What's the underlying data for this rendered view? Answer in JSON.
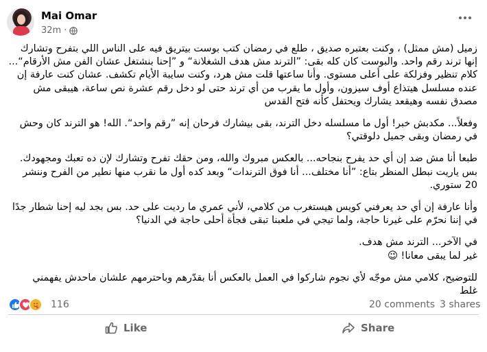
{
  "post": {
    "author": "Mai Omar",
    "time": "32m",
    "separator": "·",
    "audience_icon": "globe-icon"
  },
  "content": {
    "paragraphs": [
      {
        "lines": [
          "زميل (مش ممثل) ، وكنت بعتبره صديق ، طلع في رمضان كتب بوست بيتريق فيه على الناس اللي بتفرح وتشارك",
          "إنها ترند رقم واحد. والبوست كان كله بقى: ”الترند مش هدف الشغلانة“ و ”إحنا بنشتغل عشان الفن مش الأرقام“...",
          "كلام تنظير وفزلكة على أعلى مستوى. وأنا ساعتها قلت مش هرد، وكنت سايبة الأيام تكشف. عشان كنت عارفة إن",
          "عنده مسلسل هيتذاع أوف سيزون، وأول ما يقرب من أي ترند حتى لو دخل رقم عشرة نص ساعة، هيبقى مش",
          "مصدق نفسه وهيقعد يشارك ويحتفل كأنه فتح القدس"
        ]
      },
      {
        "lines": [
          "وفعلاً... مكدبش خبر! أول ما مسلسله دخل الترند، بقى بيشارك فرحان إنه ”رقم واحد“. الله! هو الترند كان وحش",
          "في رمضان وبقى جميل دلوقتي؟"
        ]
      },
      {
        "lines": [
          "طبعا أنا مش ضد إن أي حد يفرح بنجاحه... بالعكس مبروك والله، ومن حقك تفرح وتشارك لإن ده تعبك ومجهودك.",
          "بس ياريت نبطل المنظر بتاع: ”أنا مختلف... أنا فوق الترندات“ وبعد كده أول ما نقرب منها نطير من الفرح وننشر",
          "20 ستوري."
        ]
      },
      {
        "lines": [
          "وأنا عارفة إن أي حد يعرفني كويس هيستغرب من كلامي، لأني عمري ما رديت على حد. بس بجد ليه إحنا شطار جدًا",
          "في إننا نحرّم على غيرنا حاجة، ولما تيجي في ملعبنا تبقى فجأة أحلى حاجة في الدنيا؟"
        ]
      },
      {
        "lines": [
          "في الآخر... الترند مش هدف.",
          "غير لما يبقى معانا! 😉"
        ]
      },
      {
        "lines": [
          "للتوضيح، كلامي مش موجّه لأي نجوم شاركوا في العمل بالعكس أنا بقدّرهم وباحترمهم علشان ماحدش يفهمني",
          "غلط"
        ]
      }
    ]
  },
  "reactions": {
    "types": [
      "like-icon",
      "love-icon",
      "care-icon"
    ],
    "count": "116",
    "comments": "20 comments",
    "shares": "3 shares"
  },
  "actions": {
    "like_label": "Like",
    "share_label": "Share"
  },
  "colors": {
    "secondary_text": "#65676b",
    "like_blue": "#1877f2",
    "love_red": "#f33e58",
    "care_yellow": "#f7b125"
  }
}
